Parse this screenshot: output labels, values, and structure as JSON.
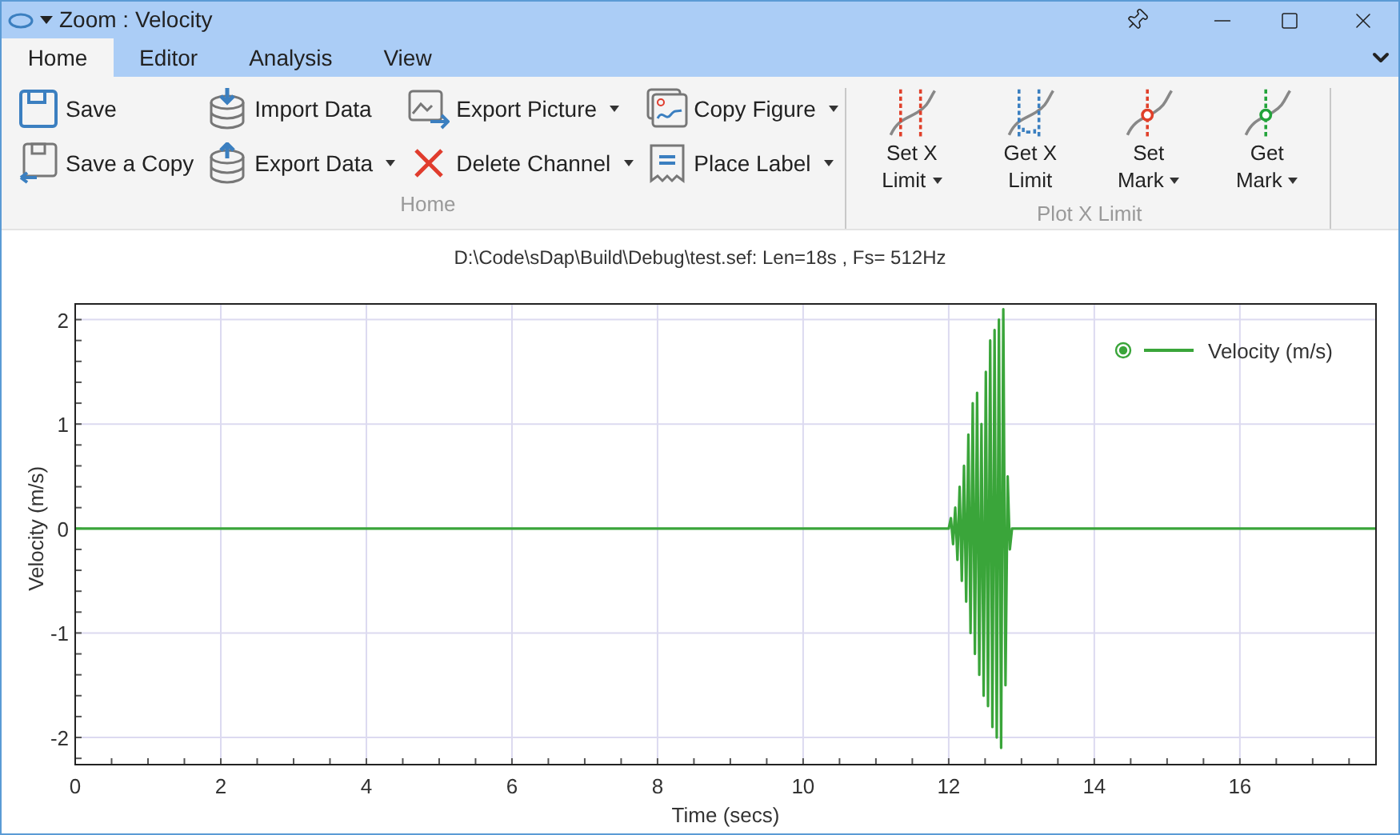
{
  "window": {
    "title": "Zoom : Velocity"
  },
  "tabs": [
    {
      "label": "Home",
      "selected": true
    },
    {
      "label": "Editor",
      "selected": false
    },
    {
      "label": "Analysis",
      "selected": false
    },
    {
      "label": "View",
      "selected": false
    }
  ],
  "ribbon": {
    "groups": [
      {
        "label": "Home",
        "columns": [
          [
            {
              "label": "Save",
              "dropdown": false
            },
            {
              "label": "Save a Copy",
              "dropdown": false
            }
          ],
          [
            {
              "label": "Import Data",
              "dropdown": false
            },
            {
              "label": "Export Data",
              "dropdown": true
            }
          ],
          [
            {
              "label": "Export Picture",
              "dropdown": true
            },
            {
              "label": "Delete Channel",
              "dropdown": true
            }
          ],
          [
            {
              "label": "Copy Figure",
              "dropdown": true
            },
            {
              "label": "Place Label",
              "dropdown": true
            }
          ]
        ]
      },
      {
        "label": "Plot X Limit",
        "large": [
          {
            "lines": [
              "Set X",
              "Limit"
            ],
            "dropdown": true
          },
          {
            "lines": [
              "Get X",
              "Limit"
            ],
            "dropdown": false
          },
          {
            "lines": [
              "Set",
              "Mark"
            ],
            "dropdown": true
          },
          {
            "lines": [
              "Get",
              "Mark"
            ],
            "dropdown": true
          }
        ]
      }
    ]
  },
  "plot": {
    "title": "D:\\Code\\sDap\\Build\\Debug\\test.sef: Len=18s , Fs= 512Hz",
    "chart_data": {
      "type": "line",
      "xlabel": "Time (secs)",
      "ylabel": "Velocity (m/s)",
      "xlim": [
        0,
        17.87
      ],
      "ylim": [
        -2.26,
        2.15
      ],
      "grid": true,
      "xticks": [
        {
          "value": 0,
          "label": "0"
        },
        {
          "value": 2,
          "label": "2"
        },
        {
          "value": 4,
          "label": "4"
        },
        {
          "value": 6,
          "label": "6"
        },
        {
          "value": 8,
          "label": "8"
        },
        {
          "value": 10,
          "label": "10"
        },
        {
          "value": 12,
          "label": "12"
        },
        {
          "value": 14,
          "label": "14"
        },
        {
          "value": 16,
          "label": "16"
        }
      ],
      "yticks": [
        {
          "value": -2,
          "label": "-2"
        },
        {
          "value": -1,
          "label": "-1"
        },
        {
          "value": 0,
          "label": "0"
        },
        {
          "value": 1,
          "label": "1"
        },
        {
          "value": 2,
          "label": "2"
        }
      ],
      "x": [
        0,
        12,
        12.03,
        12.06,
        12.09,
        12.12,
        12.15,
        12.18,
        12.21,
        12.24,
        12.27,
        12.3,
        12.33,
        12.36,
        12.39,
        12.42,
        12.45,
        12.48,
        12.51,
        12.54,
        12.57,
        12.6,
        12.63,
        12.66,
        12.69,
        12.72,
        12.75,
        12.78,
        12.81,
        12.84,
        12.87,
        17.87
      ],
      "series": [
        {
          "name": "Velocity (m/s)",
          "color": "#3aa53a",
          "values": [
            0,
            0,
            0.1,
            -0.15,
            0.2,
            -0.3,
            0.4,
            -0.5,
            0.6,
            -0.7,
            0.9,
            -1.0,
            1.2,
            -1.2,
            1.3,
            -1.4,
            1.0,
            -1.6,
            1.5,
            -1.7,
            1.8,
            -1.9,
            1.9,
            -2.0,
            2.0,
            -2.1,
            2.1,
            -1.5,
            0.5,
            -0.2,
            0,
            0
          ]
        }
      ]
    }
  }
}
